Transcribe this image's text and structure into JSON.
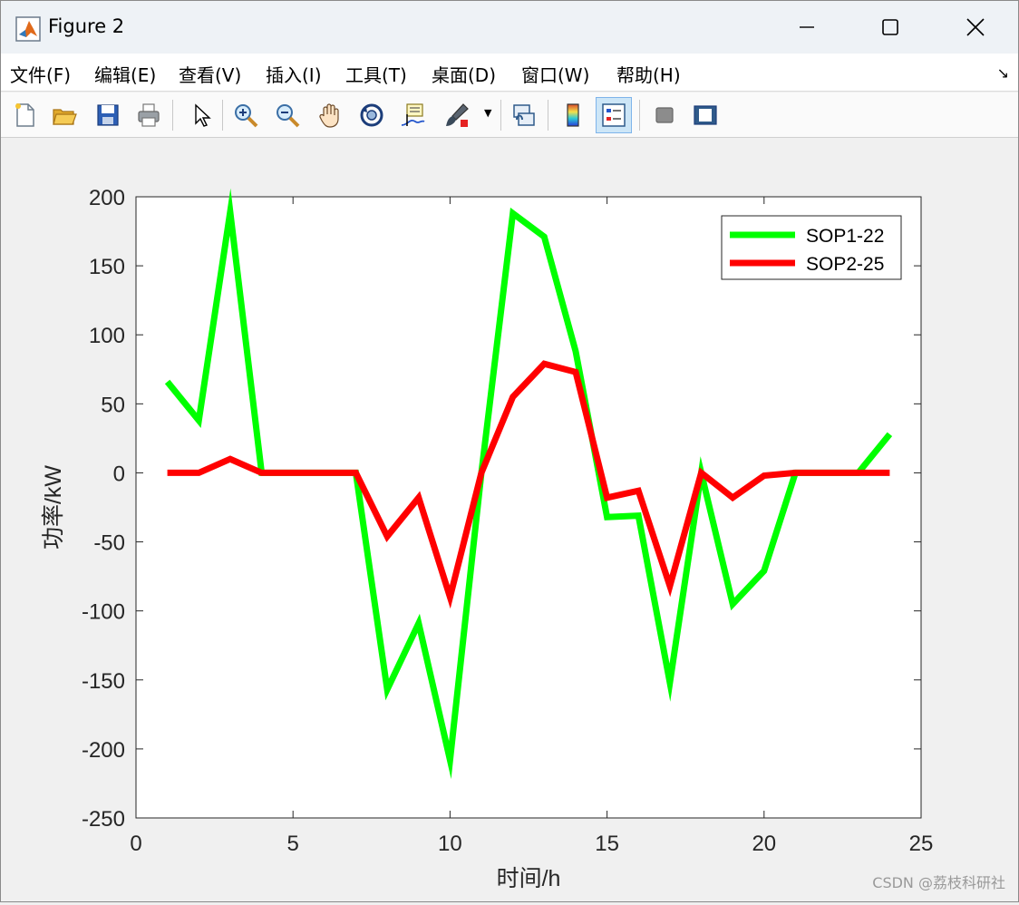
{
  "window": {
    "title": "Figure 2",
    "controls": {
      "minimize": "minimize",
      "maximize": "maximize",
      "close": "close"
    }
  },
  "menu": {
    "items": [
      "文件(F)",
      "编辑(E)",
      "查看(V)",
      "插入(I)",
      "工具(T)",
      "桌面(D)",
      "窗口(W)",
      "帮助(H)"
    ]
  },
  "toolbar": {
    "buttons": [
      "new-figure-icon",
      "open-file-icon",
      "save-icon",
      "print-icon",
      "pointer-icon",
      "zoom-in-icon",
      "zoom-out-icon",
      "pan-hand-icon",
      "rotate-3d-icon",
      "data-cursor-icon",
      "brush-icon",
      "link-plot-icon",
      "colorbar-icon",
      "legend-icon",
      "hide-plot-tools-icon",
      "show-plot-tools-icon"
    ]
  },
  "watermark": "CSDN @荔枝科研社",
  "chart_data": {
    "type": "line",
    "xlabel": "时间/h",
    "ylabel": "功率/kW",
    "xlim": [
      0,
      25
    ],
    "ylim": [
      -250,
      200
    ],
    "xticks": [
      0,
      5,
      10,
      15,
      20,
      25
    ],
    "yticks": [
      200,
      150,
      100,
      50,
      0,
      -50,
      -100,
      -150,
      -200,
      -250
    ],
    "legend_position": "top-right",
    "grid": false,
    "x": [
      1,
      2,
      3,
      4,
      5,
      6,
      7,
      8,
      9,
      10,
      11,
      12,
      13,
      14,
      15,
      16,
      17,
      18,
      19,
      20,
      21,
      22,
      23,
      24
    ],
    "series": [
      {
        "name": "SOP1-22",
        "color": "#00ff00",
        "values": [
          66,
          38,
          189,
          0,
          0,
          0,
          0,
          -157,
          -109,
          -208,
          0,
          188,
          171,
          88,
          -32,
          -31,
          -152,
          0,
          -95,
          -71,
          0,
          0,
          0,
          28
        ]
      },
      {
        "name": "SOP2-25",
        "color": "#ff0000",
        "values": [
          0,
          0,
          10,
          0,
          0,
          0,
          0,
          -46,
          -18,
          -90,
          0,
          55,
          79,
          73,
          -18,
          -13,
          -82,
          0,
          -18,
          -2,
          0,
          0,
          0,
          0
        ]
      }
    ]
  }
}
